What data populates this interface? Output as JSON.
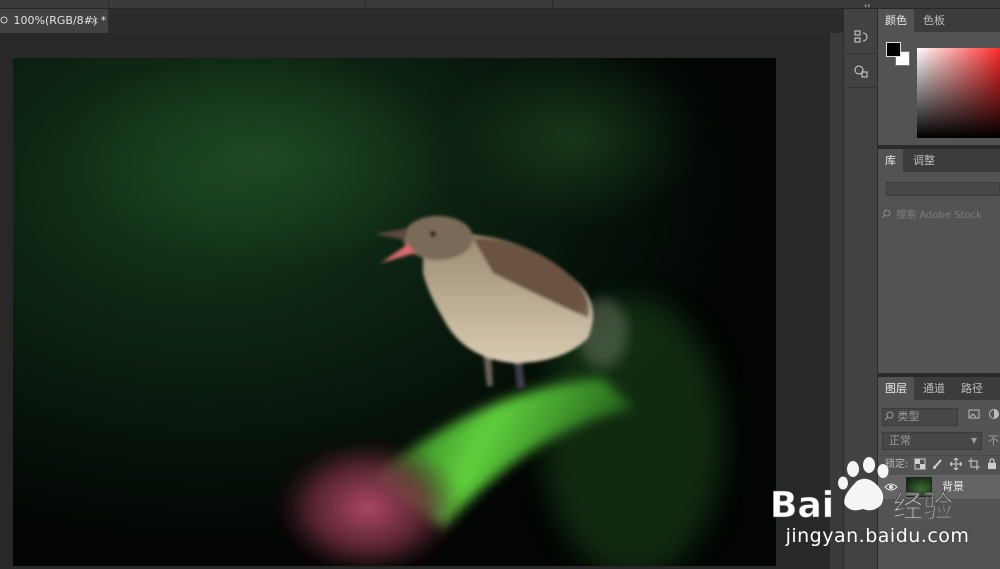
{
  "document_tab": {
    "title": "100%(RGB/8#) *",
    "close_glyph": "×",
    "icon": "ps-doc-icon"
  },
  "dock": {
    "collapse_glyph": "‹‹",
    "buttons": [
      {
        "name": "history-icon"
      },
      {
        "name": "properties-icon"
      }
    ]
  },
  "color_panel": {
    "tabs": [
      "颜色",
      "色板"
    ],
    "active_tab": "颜色",
    "foreground": "#000000",
    "background": "#ffffff",
    "spectrum_hue": "#ff2a2a"
  },
  "library_panel": {
    "tabs": [
      "库",
      "调整"
    ],
    "active_tab": "库",
    "search_placeholder": "搜索 Adobe Stock"
  },
  "layers_panel": {
    "tabs": [
      "图层",
      "通道",
      "路径"
    ],
    "active_tab": "图层",
    "filter_label": "类型",
    "blend_mode": "正常",
    "opacity_label": "不",
    "lock_label": "锁定:",
    "layers": [
      {
        "name": "背景",
        "visible": true
      }
    ]
  },
  "watermark": {
    "brand": "Baidu经验",
    "url": "jingyan.baidu.com"
  },
  "colors": {
    "app_bg": "#282828",
    "panel_bg": "#535353",
    "dock_bg": "#424242",
    "accent": "#ff2a2a"
  }
}
